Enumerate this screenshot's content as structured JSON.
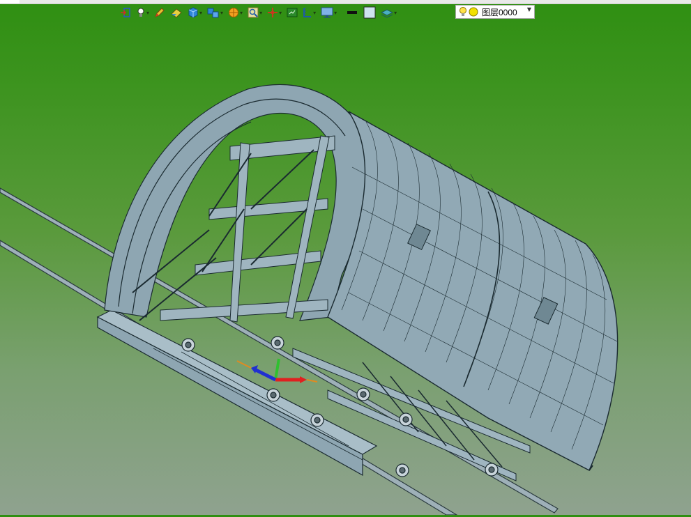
{
  "app": {
    "toolbar": {
      "tools": [
        {
          "icon": "insert-icon",
          "has_dropdown": false
        },
        {
          "icon": "light-bulb-icon",
          "has_dropdown": true
        },
        {
          "icon": "pencil-icon",
          "has_dropdown": false
        },
        {
          "icon": "eraser-icon",
          "has_dropdown": false
        },
        {
          "icon": "solid-cube-icon",
          "has_dropdown": true
        },
        {
          "icon": "cube-stack-icon",
          "has_dropdown": true
        },
        {
          "icon": "render-sphere-icon",
          "has_dropdown": true
        },
        {
          "icon": "zoom-icon",
          "has_dropdown": true
        },
        {
          "icon": "move-axes-icon",
          "has_dropdown": true
        },
        {
          "icon": "view-screen-icon",
          "has_dropdown": false
        },
        {
          "icon": "measure-icon",
          "has_dropdown": true
        },
        {
          "icon": "display-monitor-icon",
          "has_dropdown": true
        },
        {
          "icon": "line-color-icon",
          "has_dropdown": false
        },
        {
          "icon": "fill-color-icon",
          "has_dropdown": false
        },
        {
          "icon": "layer-stack-icon",
          "has_dropdown": true
        }
      ]
    },
    "layer_selector": {
      "value": "图层0000",
      "colors": {
        "bulb": "#f5d000",
        "layer": "#f2e000"
      }
    },
    "viewport": {
      "model": "tunnel-formwork-trolley",
      "colors": {
        "model_fill": "#8ea6b2",
        "model_line": "#1a2a30",
        "background_top": "#2f8f12",
        "background_bottom": "#8fa28f"
      }
    }
  }
}
